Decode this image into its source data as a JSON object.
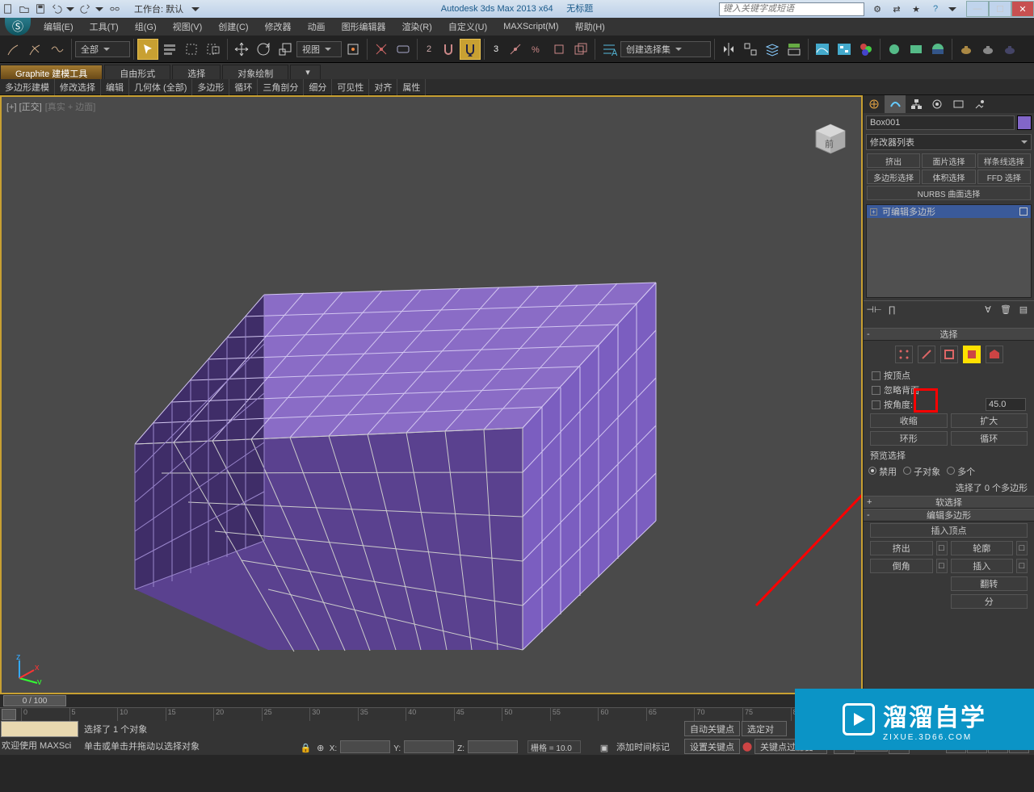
{
  "titlebar": {
    "workspace_label": "工作台: 默认",
    "app_title": "Autodesk 3ds Max  2013 x64",
    "doc_title": "无标题",
    "search_placeholder": "键入关键字或短语"
  },
  "menu": [
    "编辑(E)",
    "工具(T)",
    "组(G)",
    "视图(V)",
    "创建(C)",
    "修改器",
    "动画",
    "图形编辑器",
    "渲染(R)",
    "自定义(U)",
    "MAXScript(M)",
    "帮助(H)"
  ],
  "maintb": {
    "filter_drop": "全部",
    "refcoord_drop": "视图",
    "named_sel_drop": "创建选择集"
  },
  "ribbon": {
    "tabs": [
      "Graphite 建模工具",
      "自由形式",
      "选择",
      "对象绘制"
    ],
    "sub": [
      "多边形建模",
      "修改选择",
      "编辑",
      "几何体 (全部)",
      "多边形",
      "循环",
      "三角剖分",
      "细分",
      "可见性",
      "对齐",
      "属性"
    ]
  },
  "viewport": {
    "label_a": "[+]  [正交]",
    "label_b": "[真实 + 边面]"
  },
  "right": {
    "object_name": "Box001",
    "mod_list_label": "修改器列表",
    "mod_buttons": [
      "挤出",
      "面片选择",
      "样条线选择",
      "多边形选择",
      "体积选择",
      "FFD 选择"
    ],
    "nurbs_label": "NURBS 曲面选择",
    "stack_item": "可编辑多边形",
    "rollouts": {
      "select": "选择",
      "by_vertex": "按顶点",
      "ignore_back": "忽略背面",
      "by_angle": "按角度:",
      "angle_val": "45.0",
      "shrink": "收缩",
      "grow": "扩大",
      "ring": "环形",
      "loop": "循环",
      "preview_label": "预览选择",
      "disable": "禁用",
      "sub_obj": "子对象",
      "multi": "多个",
      "sel_count": "选择了 0 个多边形",
      "soft_sel": "软选择",
      "edit_poly": "编辑多边形",
      "insert_vert": "插入顶点",
      "extrude": "挤出",
      "outline": "轮廓",
      "bevel": "倒角",
      "inset": "插入",
      "flip": "翻转",
      "hinge_partial": "分"
    }
  },
  "timeline": {
    "slider": "0 / 100"
  },
  "status": {
    "maxs_label": "欢迎使用  MAXSci",
    "sel_msg": "选择了 1 个对象",
    "hint": "单击或单击并拖动以选择对象",
    "grid": "栅格 = 10.0",
    "add_time_tag": "添加时间标记",
    "auto_key": "自动关键点",
    "set_key": "设置关键点",
    "sel_set": "选定对",
    "key_filter": "关键点过滤器"
  },
  "watermark": {
    "big": "溜溜自学",
    "small": "ZIXUE.3D66.COM"
  }
}
